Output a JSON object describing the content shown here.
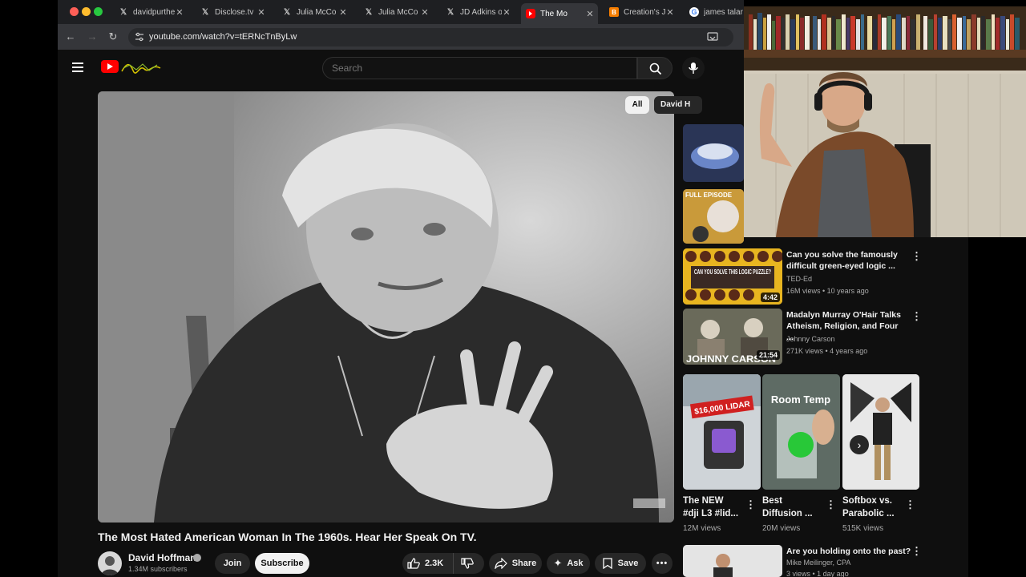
{
  "browser": {
    "tabs": [
      {
        "label": "davidpurthe",
        "favicon": "x-icon",
        "active": false
      },
      {
        "label": "Disclose.tv",
        "favicon": "x-icon",
        "active": false
      },
      {
        "label": "Julia McCo",
        "favicon": "x-icon",
        "active": false
      },
      {
        "label": "Julia McCo",
        "favicon": "x-icon",
        "active": false
      },
      {
        "label": "JD Adkins o",
        "favicon": "x-icon",
        "active": false
      },
      {
        "label": "The Mo",
        "favicon": "youtube-icon",
        "active": true
      },
      {
        "label": "Creation's J",
        "favicon": "blogger-icon",
        "active": false
      },
      {
        "label": "james talar",
        "favicon": "google-icon",
        "active": false
      }
    ],
    "url": "youtube.com/watch?v=tERNcTnByLw"
  },
  "youtube": {
    "search_placeholder": "Search"
  },
  "video": {
    "title": "The Most Hated American Woman In The 1960s. Hear Her Speak On TV.",
    "channel": "David Hoffman",
    "subscribers": "1.34M subscribers",
    "join_label": "Join",
    "subscribe_label": "Subscribe",
    "likes": "2.3K",
    "share_label": "Share",
    "ask_label": "Ask",
    "save_label": "Save"
  },
  "sidebar": {
    "chips": [
      "All",
      "David H"
    ],
    "recommendations": [
      {
        "title": "Can you solve the famously difficult green-eyed logic ...",
        "channel": "TED-Ed",
        "meta": "16M views • 10 years ago",
        "duration": "4:42"
      },
      {
        "title": "Madalyn Murray O'Hair Talks Atheism, Religion, and Four ...",
        "channel": "Johnny Carson",
        "meta": "271K views • 4 years ago",
        "duration": "21:54"
      },
      {
        "title": "Are you holding onto the past?",
        "channel": "Mike Meilinger, CPA",
        "meta": "3 views • 1 day ago",
        "duration": ""
      }
    ],
    "thumb_text": {
      "full_episode": "FULL EPISODE",
      "logic_puzzle": "CAN YOU SOLVE THIS LOGIC PUZZLE?",
      "johnny_carson": "JOHNNY CARSON",
      "lidar_price": "$16,000 LIDAR",
      "room_temp": "Room Temp"
    },
    "shorts": [
      {
        "title": "The NEW #dji L3 #lid...",
        "views": "12M views"
      },
      {
        "title": "Best Diffusion ...",
        "views": "20M views"
      },
      {
        "title": "Softbox vs. Parabolic ...",
        "views": "515K views"
      }
    ]
  },
  "colors": {
    "youtube_red": "#ff0000",
    "background": "#0f0f0f",
    "chip_bg": "#272727"
  }
}
